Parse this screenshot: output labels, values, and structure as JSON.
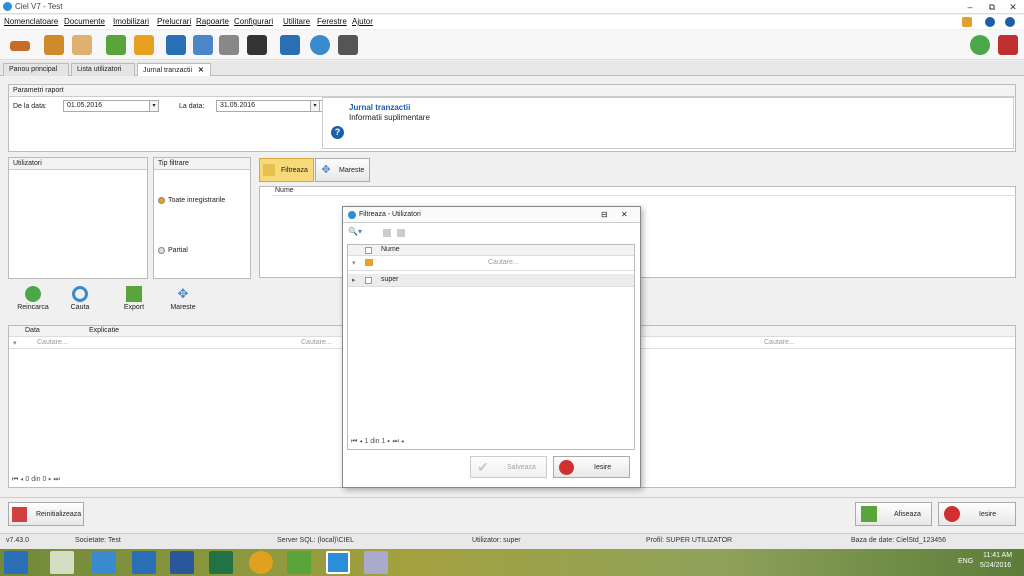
{
  "window": {
    "title": "Ciel V7 - Test",
    "min": "‒",
    "restore": "⧉",
    "close": "✕"
  },
  "menu": [
    "Nomenclatoare",
    "Documente",
    "Imobilizari",
    "Prelucrari",
    "Rapoarte",
    "Configurari",
    "Utilitare",
    "Ferestre",
    "Ajutor"
  ],
  "tabs": [
    "Panou principal",
    "Lista utilizatori",
    "Jurnal tranzactii"
  ],
  "tab_close": "✕",
  "params": {
    "header": "Parametri raport",
    "from_label": "De la data:",
    "from_value": "01.05.2016",
    "to_label": "La data:",
    "to_value": "31.05.2016",
    "info_title": "Jurnal tranzactii",
    "info_sub": "Informatii suplimentare"
  },
  "users_panel": {
    "header": "Utilizatori"
  },
  "filter_type": {
    "header": "Tip filtrare",
    "opt_all": "Toate inregistrarile",
    "opt_partial": "Partial"
  },
  "filter_buttons": {
    "filter": "Filtreaza",
    "enlarge": "Mareste"
  },
  "name_header": "Nume",
  "actions": {
    "reload": "Reincarca",
    "search": "Cauta",
    "export": "Export",
    "enlarge": "Mareste"
  },
  "grid": {
    "columns": [
      "Data",
      "Explicatie"
    ],
    "search_placeholder": "Cautare...",
    "pager": "0 din 0"
  },
  "dialog": {
    "title": "Filtreaza - Utilizatori",
    "col_name": "Nume",
    "search_placeholder": "Cautare...",
    "rows": [
      "super"
    ],
    "pager": "1 din 1",
    "save": "Salveaza",
    "exit": "Iesire"
  },
  "bottom": {
    "reset": "Reinitializeaza",
    "show": "Afiseaza",
    "exit": "Iesire"
  },
  "status": {
    "version": "v7.43.0",
    "company": "Societate: Test",
    "server": "Server SQL: (local)\\CIEL",
    "user": "Utilizator: super",
    "profile": "Profil: SUPER UTILIZATOR",
    "db": "Baza de date: CielStd_123456"
  },
  "taskbar": {
    "lang": "ENG",
    "time": "11:41 AM",
    "date": "5/24/2016"
  },
  "colors": {
    "accent": "#2a6fb5",
    "link": "#1c5ea8",
    "filter_btn": "#f7d97a"
  }
}
